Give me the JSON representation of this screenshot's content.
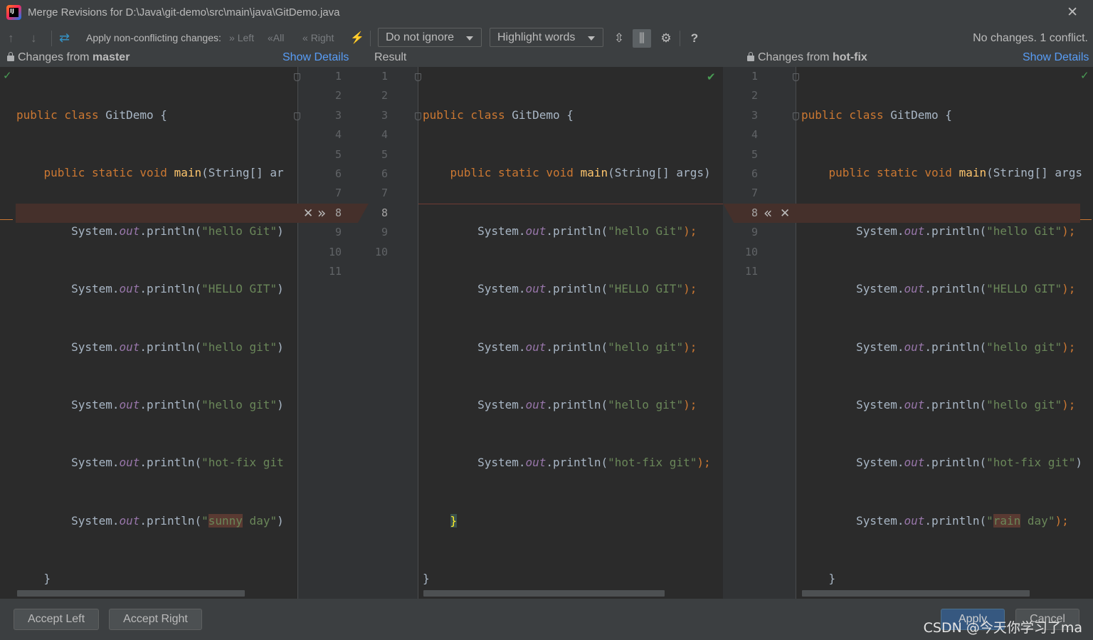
{
  "window": {
    "title": "Merge Revisions for D:\\Java\\git-demo\\src\\main\\java\\GitDemo.java",
    "app_icon_text": "IJ"
  },
  "toolbar": {
    "apply_label": "Apply non-conflicting changes:",
    "left_label": "Left",
    "all_label": "All",
    "right_label": "Right",
    "ignore_dropdown": "Do not ignore",
    "highlight_dropdown": "Highlight words",
    "help_label": "?",
    "status": "No changes. 1 conflict."
  },
  "headers": {
    "left_prefix": "Changes from ",
    "left_branch": "master",
    "left_show_details": "Show Details",
    "result": "Result",
    "right_prefix": "Changes from ",
    "right_branch": "hot-fix",
    "right_show_details": "Show Details"
  },
  "line_numbers": {
    "left": [
      "1",
      "2",
      "3",
      "4",
      "5",
      "6",
      "7",
      "8",
      "9",
      "10",
      "11"
    ],
    "result": [
      "1",
      "2",
      "3",
      "4",
      "5",
      "6",
      "7",
      "8",
      "9",
      "10"
    ],
    "right": [
      "1",
      "2",
      "3",
      "4",
      "5",
      "6",
      "7",
      "8",
      "9",
      "10",
      "11"
    ]
  },
  "code": {
    "left": {
      "l1": [
        "public class ",
        "GitDemo {"
      ],
      "l2": [
        "public static void ",
        "main",
        "(String[] ar"
      ],
      "l3": [
        "System.",
        "out",
        ".println(",
        "\"hello Git\"",
        ")"
      ],
      "l4": [
        "System.",
        "out",
        ".println(",
        "\"HELLO GIT\"",
        ")"
      ],
      "l5": [
        "System.",
        "out",
        ".println(",
        "\"hello git\"",
        ")"
      ],
      "l6": [
        "System.",
        "out",
        ".println(",
        "\"hello git\"",
        ")"
      ],
      "l7": [
        "System.",
        "out",
        ".println(",
        "\"hot-fix git"
      ],
      "l8": [
        "System.",
        "out",
        ".println(",
        "\"",
        "sunny",
        " day\"",
        ")"
      ],
      "l9": "}",
      "l10": "}"
    },
    "result": {
      "l1": [
        "public class ",
        "GitDemo {"
      ],
      "l2": [
        "public static void ",
        "main",
        "(String[] args)"
      ],
      "l3": [
        "System.",
        "out",
        ".println(",
        "\"hello Git\"",
        ");"
      ],
      "l4": [
        "System.",
        "out",
        ".println(",
        "\"HELLO GIT\"",
        ");"
      ],
      "l5": [
        "System.",
        "out",
        ".println(",
        "\"hello git\"",
        ");"
      ],
      "l6": [
        "System.",
        "out",
        ".println(",
        "\"hello git\"",
        ");"
      ],
      "l7": [
        "System.",
        "out",
        ".println(",
        "\"hot-fix git\"",
        ");"
      ],
      "l8": "}",
      "l9": "}"
    },
    "right": {
      "l1": [
        "public class ",
        "GitDemo {"
      ],
      "l2": [
        "public static void ",
        "main",
        "(String[] args"
      ],
      "l3": [
        "System.",
        "out",
        ".println(",
        "\"hello Git\"",
        ");"
      ],
      "l4": [
        "System.",
        "out",
        ".println(",
        "\"HELLO GIT\"",
        ");"
      ],
      "l5": [
        "System.",
        "out",
        ".println(",
        "\"hello git\"",
        ");"
      ],
      "l6": [
        "System.",
        "out",
        ".println(",
        "\"hello git\"",
        ");"
      ],
      "l7": [
        "System.",
        "out",
        ".println(",
        "\"hot-fix git\"",
        ")"
      ],
      "l8": [
        "System.",
        "out",
        ".println(",
        "\"",
        "rain",
        " day\"",
        ");"
      ],
      "l9": "}",
      "l10": "}"
    }
  },
  "buttons": {
    "accept_left": "Accept Left",
    "accept_right": "Accept Right",
    "apply": "Apply",
    "cancel": "Cancel"
  },
  "watermark": "CSDN @今天你学习了ma",
  "colors": {
    "keyword": "#cc7832",
    "string": "#6a8759",
    "field": "#9876aa",
    "method": "#ffc66d",
    "conflict": "#45302b",
    "link": "#589df6"
  }
}
